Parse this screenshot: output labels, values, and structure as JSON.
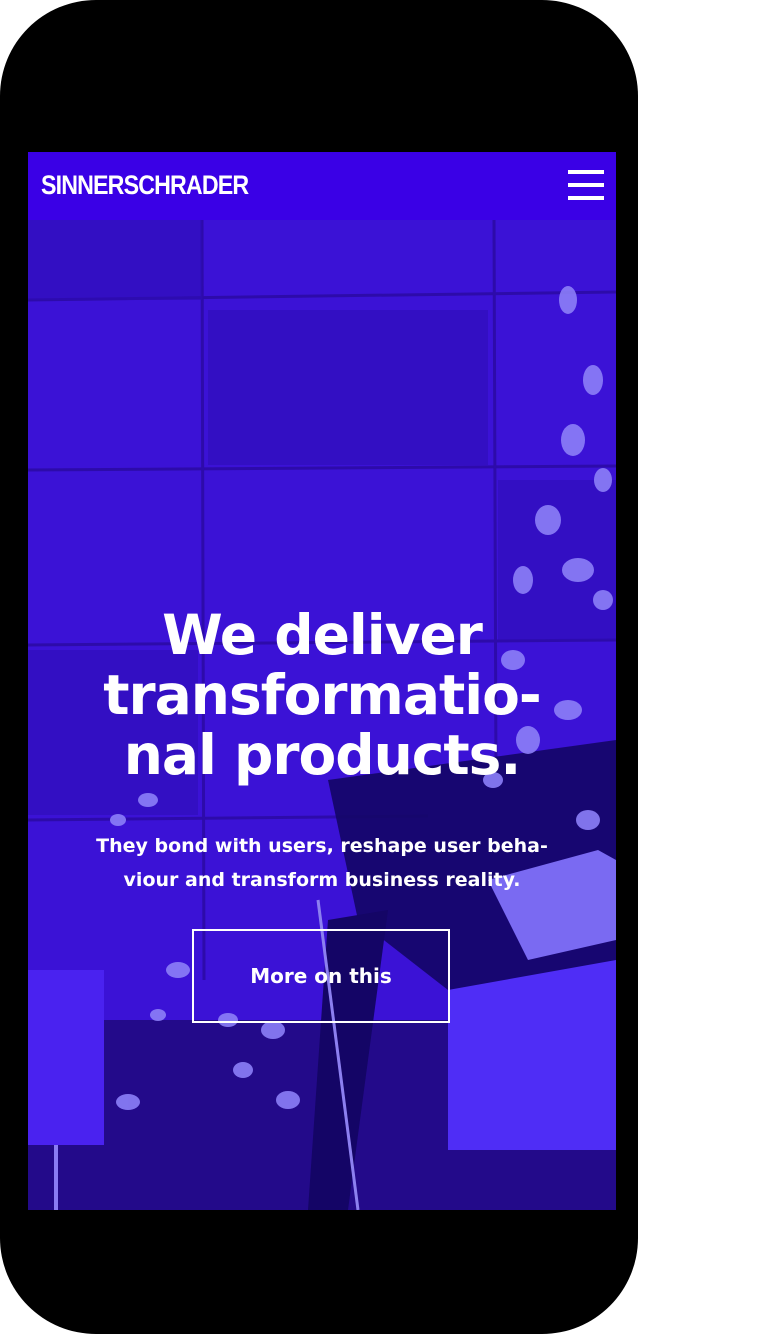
{
  "header": {
    "logo_text": "SINNERSCHRADER",
    "menu_icon": "hamburger-menu-icon",
    "background": "#3a00e6"
  },
  "hero": {
    "title_lines": [
      "We deliver",
      "transformatio-",
      "nal products."
    ],
    "subtitle_lines": [
      "They bond with users, reshape user beha-",
      "viour and transform business reality."
    ],
    "cta_label": "More on this",
    "tint_color": "#3a10d8"
  }
}
